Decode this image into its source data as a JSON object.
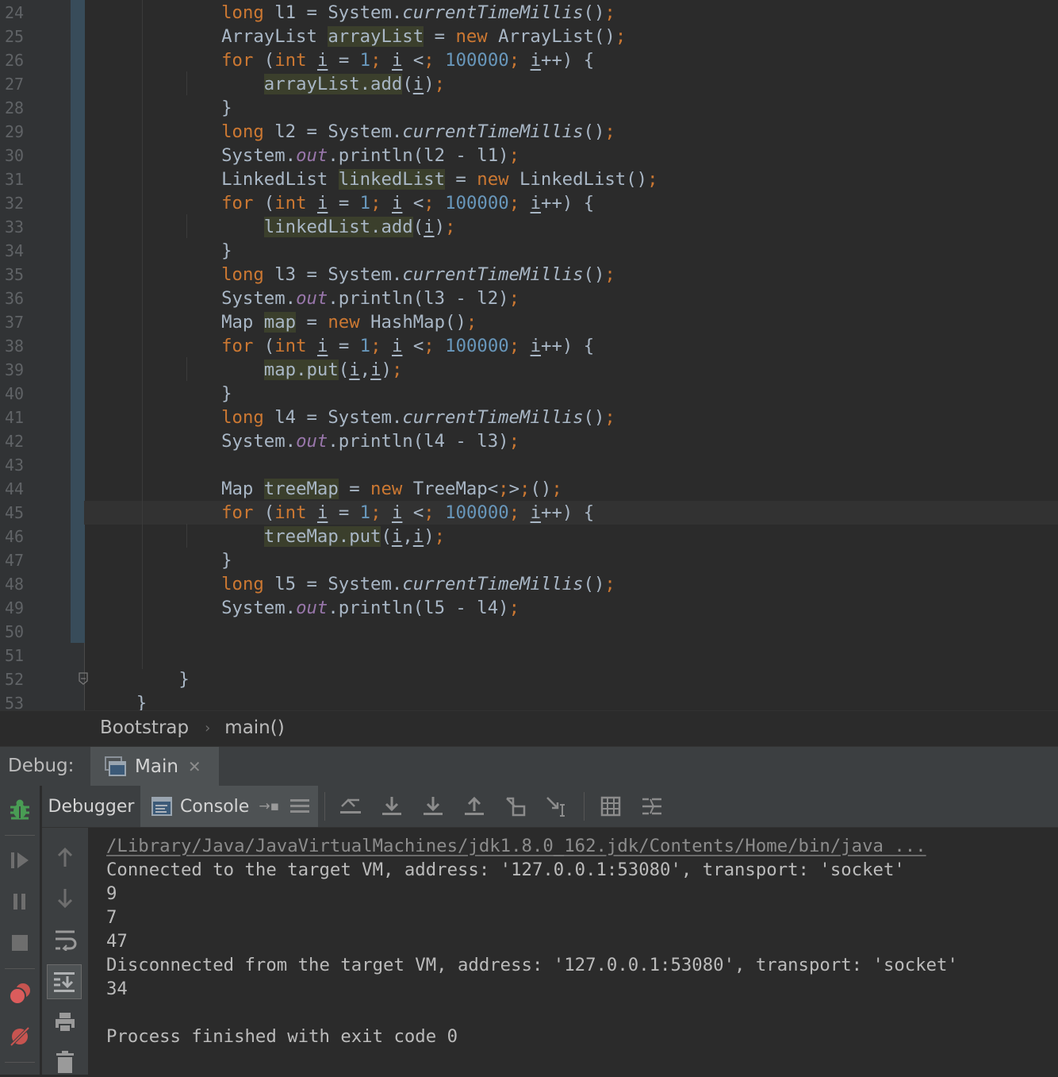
{
  "editor": {
    "lines": [
      {
        "n": "24",
        "code": "            long l1 = System.currentTimeMillis();"
      },
      {
        "n": "25",
        "code": "            ArrayList arrayList = new ArrayList();"
      },
      {
        "n": "26",
        "code": "            for (int i = 1; i < 100000; i++) {"
      },
      {
        "n": "27",
        "code": "                arrayList.add(i);"
      },
      {
        "n": "28",
        "code": "            }"
      },
      {
        "n": "29",
        "code": "            long l2 = System.currentTimeMillis();"
      },
      {
        "n": "30",
        "code": "            System.out.println(l2 - l1);"
      },
      {
        "n": "31",
        "code": "            LinkedList linkedList = new LinkedList();"
      },
      {
        "n": "32",
        "code": "            for (int i = 1; i < 100000; i++) {"
      },
      {
        "n": "33",
        "code": "                linkedList.add(i);"
      },
      {
        "n": "34",
        "code": "            }"
      },
      {
        "n": "35",
        "code": "            long l3 = System.currentTimeMillis();"
      },
      {
        "n": "36",
        "code": "            System.out.println(l3 - l2);"
      },
      {
        "n": "37",
        "code": "            Map map = new HashMap();"
      },
      {
        "n": "38",
        "code": "            for (int i = 1; i < 100000; i++) {"
      },
      {
        "n": "39",
        "code": "                map.put(i,i);"
      },
      {
        "n": "40",
        "code": "            }"
      },
      {
        "n": "41",
        "code": "            long l4 = System.currentTimeMillis();"
      },
      {
        "n": "42",
        "code": "            System.out.println(l4 - l3);"
      },
      {
        "n": "43",
        "code": ""
      },
      {
        "n": "44",
        "code": "            Map treeMap = new TreeMap<>();"
      },
      {
        "n": "45",
        "code": "            for (int i = 1; i < 100000; i++) {"
      },
      {
        "n": "46",
        "code": "                treeMap.put(i,i);"
      },
      {
        "n": "47",
        "code": "            }"
      },
      {
        "n": "48",
        "code": "            long l5 = System.currentTimeMillis();"
      },
      {
        "n": "49",
        "code": "            System.out.println(l5 - l4);"
      },
      {
        "n": "50",
        "code": ""
      },
      {
        "n": "51",
        "code": ""
      },
      {
        "n": "52",
        "code": "        }"
      },
      {
        "n": "53",
        "code": "    }"
      }
    ]
  },
  "breadcrumb": {
    "class_name": "Bootstrap",
    "method_name": "main()"
  },
  "debug": {
    "label": "Debug:",
    "run_config_tab": "Main",
    "tabs": {
      "debugger": "Debugger",
      "console": "Console"
    }
  },
  "console": {
    "lines": [
      "/Library/Java/JavaVirtualMachines/jdk1.8.0_162.jdk/Contents/Home/bin/java ...",
      "Connected to the target VM, address: '127.0.0.1:53080', transport: 'socket'",
      "9",
      "7",
      "47",
      "Disconnected from the target VM, address: '127.0.0.1:53080', transport: 'socket'",
      "34",
      "",
      "Process finished with exit code 0"
    ]
  },
  "colors": {
    "editor_bg": "#2b2b2b",
    "keyword": "#cc7832",
    "number": "#6897bb",
    "field": "#9876aa",
    "text": "#a9b7c6",
    "tool_window_bg": "#3c3f41"
  },
  "icons": [
    "debug-bug-icon",
    "resume-icon",
    "pause-icon",
    "stop-icon",
    "view-breakpoints-icon",
    "mute-breakpoints-icon",
    "up-arrow-icon",
    "down-arrow-icon",
    "soft-wrap-icon",
    "scroll-to-end-icon",
    "print-icon",
    "trash-icon",
    "restore-layout-icon",
    "show-execution-point-icon",
    "step-over-icon",
    "step-into-icon",
    "force-step-into-icon",
    "step-out-icon",
    "drop-frame-icon",
    "run-to-cursor-icon",
    "evaluate-expression-icon",
    "trace-icon"
  ]
}
